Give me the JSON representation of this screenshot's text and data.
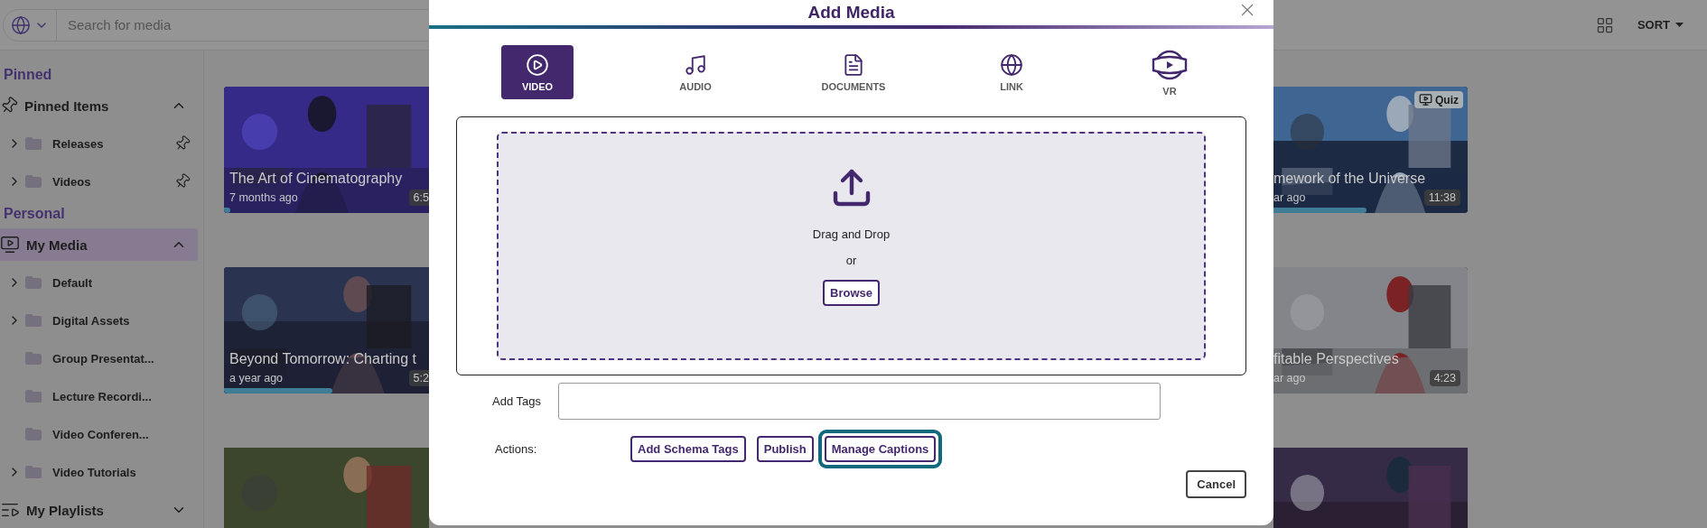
{
  "search": {
    "placeholder": "Search for media"
  },
  "toolbar": {
    "sort": "SORT"
  },
  "sidebar": {
    "sections": [
      {
        "title": "Pinned",
        "groups": [
          {
            "label": "Pinned Items",
            "expanded": true,
            "selected": false,
            "children": [
              {
                "label": "Releases",
                "expandable": true,
                "pinned": true
              },
              {
                "label": "Videos",
                "expandable": true,
                "pinned": true
              }
            ]
          }
        ]
      },
      {
        "title": "Personal",
        "groups": [
          {
            "label": "My Media",
            "expanded": true,
            "selected": true,
            "children": [
              {
                "label": "Default",
                "expandable": true,
                "pinned": false
              },
              {
                "label": "Digital Assets",
                "expandable": true,
                "pinned": false
              },
              {
                "label": "Group Presentat...",
                "expandable": false,
                "pinned": false
              },
              {
                "label": "Lecture Recordi...",
                "expandable": false,
                "pinned": false
              },
              {
                "label": "Video Conferen...",
                "expandable": false,
                "pinned": false
              },
              {
                "label": "Video Tutorials",
                "expandable": true,
                "pinned": false
              }
            ]
          },
          {
            "label": "My Playlists",
            "expanded": false,
            "selected": false
          }
        ]
      }
    ]
  },
  "columns": [
    {
      "cards": [
        {
          "title": "The Art of Cinematography",
          "age": "7 months ago",
          "duration": "6:5",
          "level": 0.03
        },
        {
          "title": "Beyond Tomorrow: Charting t",
          "age": "a year ago",
          "duration": "5:2",
          "level": 0.53
        },
        {
          "kind": "picture"
        }
      ]
    },
    {
      "cards": [
        {
          "title": "mework of the Universe",
          "age": "ar ago",
          "duration": "11:38",
          "level": 0.48,
          "badge": "Quiz"
        },
        {
          "title": "fitable Perspectives",
          "age": "ar ago",
          "duration": "4:23"
        },
        {
          "kind": "picture"
        }
      ]
    }
  ],
  "modal": {
    "title": "Add Media",
    "tabs": [
      {
        "label": "VIDEO",
        "selected": true
      },
      {
        "label": "AUDIO",
        "selected": false
      },
      {
        "label": "DOCUMENTS",
        "selected": false
      },
      {
        "label": "LINK",
        "selected": false
      },
      {
        "label": "VR",
        "selected": false
      }
    ],
    "dropzone": {
      "text": "Drag and Drop",
      "or": "or",
      "button": "Browse"
    },
    "tags": {
      "label": "Add Tags"
    },
    "actions": {
      "label": "Actions:",
      "buttons": [
        {
          "label": "Add Schema Tags",
          "focused": false
        },
        {
          "label": "Publish",
          "focused": false
        },
        {
          "label": "Manage Captions",
          "focused": true
        }
      ]
    },
    "cancel": "Cancel"
  }
}
